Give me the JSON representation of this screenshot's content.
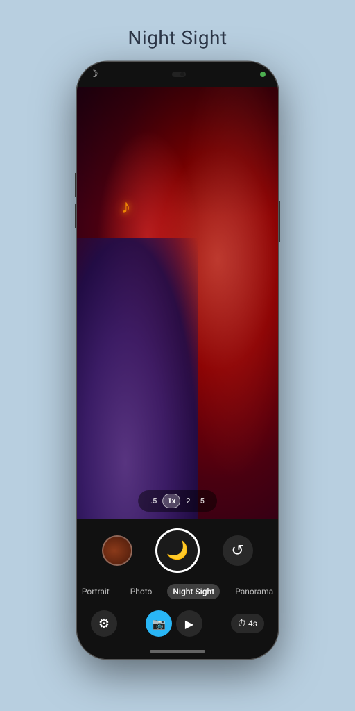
{
  "page": {
    "title": "Night Sight",
    "background_color": "#b8cfe0"
  },
  "phone": {
    "status_bar": {
      "moon_symbol": "☽",
      "indicator_color": "#4caf50"
    },
    "zoom": {
      "options": [
        {
          "label": ".5",
          "active": false
        },
        {
          "label": "1x",
          "active": true
        },
        {
          "label": "2",
          "active": false
        },
        {
          "label": "5",
          "active": false
        }
      ]
    },
    "shutter": {
      "icon": "🌙"
    },
    "modes": [
      {
        "label": "Portrait",
        "active": false
      },
      {
        "label": "Photo",
        "active": false
      },
      {
        "label": "Night Sight",
        "active": true
      },
      {
        "label": "Panorama",
        "active": false
      }
    ],
    "toolbar": {
      "settings_icon": "⚙",
      "photo_icon": "📷",
      "video_icon": "▶",
      "timer_icon": "⏱",
      "timer_label": "4s",
      "flip_icon": "↺"
    }
  }
}
